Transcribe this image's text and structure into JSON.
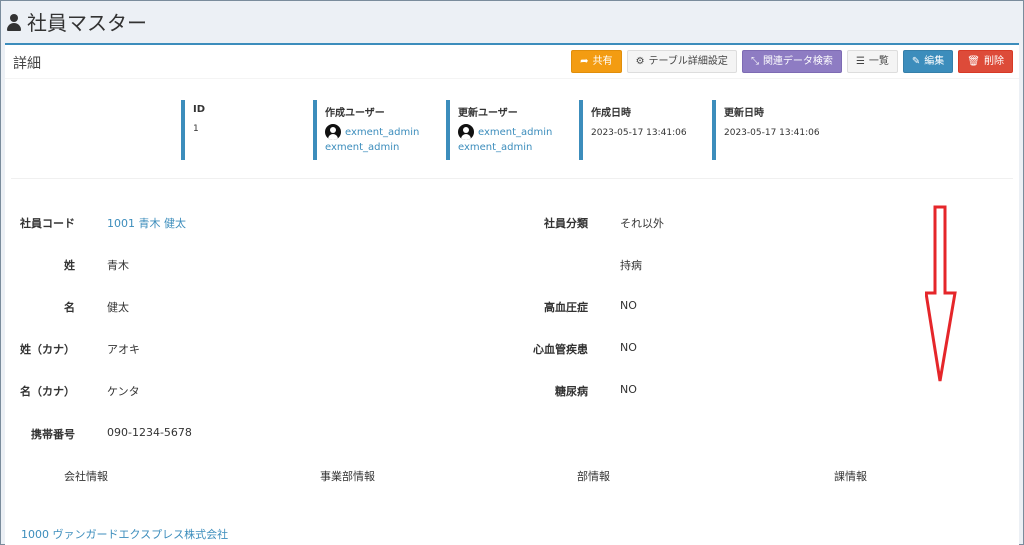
{
  "header": {
    "title": "社員マスター"
  },
  "box": {
    "title": "詳細"
  },
  "toolbar": {
    "share_label": "共有",
    "table_settings_label": "テーブル詳細設定",
    "related_search_label": "関連データ検索",
    "list_label": "一覧",
    "edit_label": "編集",
    "delete_label": "削除"
  },
  "meta": {
    "id": {
      "label": "ID",
      "value": "1"
    },
    "created_user": {
      "label": "作成ユーザー",
      "name": "exment_admin",
      "sub": "exment_admin"
    },
    "updated_user": {
      "label": "更新ユーザー",
      "name": "exment_admin",
      "sub": "exment_admin"
    },
    "created_at": {
      "label": "作成日時",
      "value": "2023-05-17 13:41:06"
    },
    "updated_at": {
      "label": "更新日時",
      "value": "2023-05-17 13:41:06"
    }
  },
  "fields_left": [
    {
      "label": "社員コード",
      "value": "1001 青木 健太"
    },
    {
      "label": "姓",
      "value": "青木"
    },
    {
      "label": "名",
      "value": "健太"
    },
    {
      "label": "姓（カナ）",
      "value": "アオキ"
    },
    {
      "label": "名（カナ）",
      "value": "ケンタ"
    },
    {
      "label": "携帯番号",
      "value": "090-1234-5678"
    }
  ],
  "fields_right": [
    {
      "label": "社員分類",
      "value": "それ以外"
    },
    {
      "label": "",
      "value": "持病"
    },
    {
      "label": "高血圧症",
      "value": "NO"
    },
    {
      "label": "心血管疾患",
      "value": "NO"
    },
    {
      "label": "糖尿病",
      "value": "NO"
    }
  ],
  "relations": {
    "tabs": [
      "会社情報",
      "事業部情報",
      "部情報",
      "課情報"
    ],
    "company_link": "1000 ヴァンガードエクスプレス株式会社"
  },
  "colors": {
    "primary": "#3c8dbc",
    "warning": "#f39c12",
    "purple": "#8e7cc3",
    "danger": "#dd4b39",
    "annotation": "#e5262a"
  }
}
